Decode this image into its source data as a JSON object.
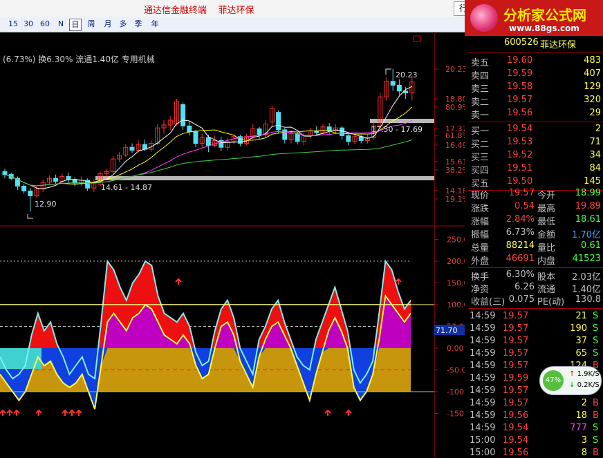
{
  "window": {
    "title": "通达信金融终端    菲达环保",
    "tab_label": "行"
  },
  "toolbar": {
    "periods": [
      "15",
      "30",
      "60",
      "N",
      "日",
      "周",
      "月",
      "多",
      "季",
      "年"
    ],
    "selected": "日"
  },
  "brand": {
    "name": "分析家公式网",
    "url": "www.88gs.com"
  },
  "price_panel": {
    "info_line": "(6.73%) 换6.30% 流通1.40亿 专用机械",
    "y_labels": [
      "20.23",
      "18.80",
      "80.9%",
      "17.37",
      "61.8%",
      "16.49",
      "15.61",
      "38.2%",
      "14.18",
      "19.1%"
    ],
    "annotations": {
      "high": "20.23",
      "low": "12.90",
      "range_upper": "17.50 - 17.69",
      "range_lower": "14.61 - 14.87"
    },
    "candles": [
      {
        "o": 14.95,
        "c": 14.8,
        "h": 15.1,
        "l": 14.6
      },
      {
        "o": 14.8,
        "c": 14.6,
        "h": 14.9,
        "l": 14.5
      },
      {
        "o": 14.6,
        "c": 14.2,
        "h": 14.7,
        "l": 14.0
      },
      {
        "o": 14.2,
        "c": 13.95,
        "h": 14.3,
        "l": 13.8
      },
      {
        "o": 13.95,
        "c": 13.7,
        "h": 14.1,
        "l": 12.9
      },
      {
        "o": 13.7,
        "c": 14.05,
        "h": 14.2,
        "l": 13.6
      },
      {
        "o": 14.05,
        "c": 14.4,
        "h": 14.55,
        "l": 13.9
      },
      {
        "o": 14.4,
        "c": 14.6,
        "h": 14.75,
        "l": 14.3
      },
      {
        "o": 14.6,
        "c": 14.45,
        "h": 14.8,
        "l": 14.3
      },
      {
        "o": 14.45,
        "c": 14.7,
        "h": 14.85,
        "l": 14.35
      },
      {
        "o": 14.7,
        "c": 14.55,
        "h": 14.9,
        "l": 14.4
      },
      {
        "o": 14.55,
        "c": 14.35,
        "h": 14.65,
        "l": 14.2
      },
      {
        "o": 14.35,
        "c": 14.5,
        "h": 14.7,
        "l": 14.2
      },
      {
        "o": 14.5,
        "c": 14.1,
        "h": 14.6,
        "l": 13.95
      },
      {
        "o": 14.1,
        "c": 14.4,
        "h": 14.55,
        "l": 13.9
      },
      {
        "o": 14.3,
        "c": 14.85,
        "h": 14.95,
        "l": 14.2
      },
      {
        "o": 14.85,
        "c": 14.95,
        "h": 15.1,
        "l": 14.7
      },
      {
        "o": 14.95,
        "c": 15.6,
        "h": 15.75,
        "l": 14.85
      },
      {
        "o": 15.6,
        "c": 15.8,
        "h": 15.95,
        "l": 15.45
      },
      {
        "o": 15.8,
        "c": 16.2,
        "h": 16.35,
        "l": 15.7
      },
      {
        "o": 16.2,
        "c": 16.05,
        "h": 16.4,
        "l": 15.9
      },
      {
        "o": 16.05,
        "c": 16.35,
        "h": 16.55,
        "l": 15.95
      },
      {
        "o": 16.35,
        "c": 16.1,
        "h": 16.6,
        "l": 16.0
      },
      {
        "o": 16.1,
        "c": 16.4,
        "h": 16.55,
        "l": 15.95
      },
      {
        "o": 16.4,
        "c": 17.2,
        "h": 17.4,
        "l": 16.3
      },
      {
        "o": 17.2,
        "c": 17.35,
        "h": 17.6,
        "l": 16.9
      },
      {
        "o": 17.35,
        "c": 17.6,
        "h": 17.8,
        "l": 17.1
      },
      {
        "o": 17.4,
        "c": 18.55,
        "h": 18.7,
        "l": 17.3
      },
      {
        "o": 18.4,
        "c": 17.3,
        "h": 18.5,
        "l": 17.1
      },
      {
        "o": 17.3,
        "c": 17.0,
        "h": 17.55,
        "l": 16.8
      },
      {
        "o": 17.0,
        "c": 16.4,
        "h": 17.1,
        "l": 16.2
      },
      {
        "o": 16.4,
        "c": 16.7,
        "h": 16.9,
        "l": 16.2
      },
      {
        "o": 16.7,
        "c": 16.3,
        "h": 16.85,
        "l": 15.95
      },
      {
        "o": 16.3,
        "c": 16.55,
        "h": 16.8,
        "l": 16.2
      },
      {
        "o": 16.55,
        "c": 16.2,
        "h": 16.75,
        "l": 16.0
      },
      {
        "o": 16.2,
        "c": 16.5,
        "h": 16.7,
        "l": 16.05
      },
      {
        "o": 16.5,
        "c": 16.75,
        "h": 16.9,
        "l": 16.35
      },
      {
        "o": 16.75,
        "c": 16.4,
        "h": 16.85,
        "l": 16.25
      },
      {
        "o": 16.4,
        "c": 16.75,
        "h": 16.9,
        "l": 16.3
      },
      {
        "o": 16.75,
        "c": 17.15,
        "h": 17.4,
        "l": 16.6
      },
      {
        "o": 17.15,
        "c": 16.85,
        "h": 17.25,
        "l": 16.6
      },
      {
        "o": 16.85,
        "c": 17.4,
        "h": 17.6,
        "l": 16.75
      },
      {
        "o": 17.5,
        "c": 18.2,
        "h": 18.35,
        "l": 17.3
      },
      {
        "o": 18.0,
        "c": 17.1,
        "h": 18.1,
        "l": 16.9
      },
      {
        "o": 17.1,
        "c": 16.6,
        "h": 17.2,
        "l": 16.4
      },
      {
        "o": 16.6,
        "c": 16.9,
        "h": 17.1,
        "l": 16.4
      },
      {
        "o": 16.9,
        "c": 16.5,
        "h": 17.0,
        "l": 16.35
      },
      {
        "o": 16.5,
        "c": 16.8,
        "h": 16.95,
        "l": 16.3
      },
      {
        "o": 16.8,
        "c": 17.05,
        "h": 17.2,
        "l": 16.65
      },
      {
        "o": 17.05,
        "c": 16.95,
        "h": 17.3,
        "l": 16.8
      },
      {
        "o": 16.95,
        "c": 17.25,
        "h": 17.4,
        "l": 16.85
      },
      {
        "o": 17.25,
        "c": 17.05,
        "h": 17.45,
        "l": 16.9
      },
      {
        "o": 17.05,
        "c": 17.2,
        "h": 17.4,
        "l": 16.9
      },
      {
        "o": 17.2,
        "c": 16.8,
        "h": 17.3,
        "l": 16.6
      },
      {
        "o": 16.8,
        "c": 16.5,
        "h": 16.95,
        "l": 16.3
      },
      {
        "o": 16.5,
        "c": 16.75,
        "h": 16.9,
        "l": 16.35
      },
      {
        "o": 16.75,
        "c": 16.55,
        "h": 16.85,
        "l": 16.4
      },
      {
        "o": 16.55,
        "c": 16.7,
        "h": 16.85,
        "l": 16.4
      },
      {
        "o": 16.7,
        "c": 17.3,
        "h": 17.5,
        "l": 16.6
      },
      {
        "o": 17.3,
        "c": 18.8,
        "h": 19.0,
        "l": 17.2
      },
      {
        "o": 18.8,
        "c": 19.6,
        "h": 19.8,
        "l": 18.6
      },
      {
        "o": 19.6,
        "c": 19.4,
        "h": 20.23,
        "l": 19.1
      },
      {
        "o": 19.4,
        "c": 19.1,
        "h": 19.7,
        "l": 18.9
      },
      {
        "o": 19.1,
        "c": 19.0,
        "h": 19.3,
        "l": 18.7
      },
      {
        "o": 19.0,
        "c": 19.57,
        "h": 19.89,
        "l": 18.61
      }
    ]
  },
  "indicator_panel": {
    "y_labels": [
      "250.00",
      "200.00",
      "150.00",
      "100.00",
      "50.00",
      "0.00",
      "-50.00",
      "-100.00",
      "-150.00"
    ],
    "current_value": "71.70",
    "upper": [
      -20,
      -50,
      -70,
      -60,
      -40,
      30,
      80,
      40,
      60,
      10,
      -20,
      -60,
      -40,
      -20,
      -60,
      -70,
      60,
      200,
      180,
      140,
      110,
      150,
      170,
      200,
      190,
      120,
      80,
      70,
      60,
      80,
      50,
      -10,
      -40,
      -30,
      40,
      90,
      110,
      70,
      0,
      -30,
      -60,
      20,
      50,
      90,
      110,
      60,
      20,
      -20,
      -40,
      -50,
      20,
      60,
      100,
      140,
      90,
      40,
      -50,
      -80,
      -60,
      -30,
      80,
      200,
      180,
      130,
      90,
      110
    ],
    "lower": [
      -60,
      -80,
      -100,
      -120,
      -100,
      -60,
      -20,
      -40,
      -30,
      -60,
      -80,
      -90,
      -80,
      -60,
      -100,
      -140,
      -40,
      60,
      80,
      60,
      40,
      70,
      80,
      100,
      90,
      60,
      30,
      20,
      10,
      30,
      10,
      -40,
      -70,
      -60,
      0,
      50,
      60,
      30,
      -30,
      -60,
      -90,
      -20,
      20,
      50,
      60,
      30,
      0,
      -40,
      -80,
      -120,
      -60,
      -10,
      40,
      70,
      40,
      0,
      -90,
      -120,
      -100,
      -60,
      20,
      120,
      100,
      80,
      60,
      80
    ]
  },
  "quote": {
    "code": "600526",
    "name": "菲达环保",
    "asks": [
      {
        "label": "卖五",
        "price": "19.60",
        "vol": "483"
      },
      {
        "label": "卖四",
        "price": "19.59",
        "vol": "407"
      },
      {
        "label": "卖三",
        "price": "19.58",
        "vol": "129"
      },
      {
        "label": "卖二",
        "price": "19.57",
        "vol": "320"
      },
      {
        "label": "卖一",
        "price": "19.56",
        "vol": "29"
      }
    ],
    "bids": [
      {
        "label": "买一",
        "price": "19.54",
        "vol": "2"
      },
      {
        "label": "买二",
        "price": "19.53",
        "vol": "71"
      },
      {
        "label": "买三",
        "price": "19.52",
        "vol": "34"
      },
      {
        "label": "买四",
        "price": "19.51",
        "vol": "84"
      },
      {
        "label": "买五",
        "price": "19.50",
        "vol": "145"
      }
    ],
    "stats": [
      {
        "l1": "现价",
        "v1": "19.57",
        "l2": "今开",
        "v2": "18.99"
      },
      {
        "l1": "涨跌",
        "v1": "0.54",
        "l2": "最高",
        "v2": "19.89"
      },
      {
        "l1": "涨幅",
        "v1": "2.84%",
        "l2": "最低",
        "v2": "18.61"
      },
      {
        "l1": "振幅",
        "v1": "6.73%",
        "l2": "金额",
        "v2": "1.70亿"
      },
      {
        "l1": "总量",
        "v1": "88214",
        "l2": "量比",
        "v2": "0.61"
      },
      {
        "l1": "外盘",
        "v1": "46691",
        "l2": "内盘",
        "v2": "41523"
      }
    ],
    "stats2": [
      {
        "l1": "换手",
        "v1": "6.30%",
        "l2": "股本",
        "v2": "2.03亿"
      },
      {
        "l1": "净资",
        "v1": "6.26",
        "l2": "流通",
        "v2": "1.40亿"
      },
      {
        "l1": "收益(三)",
        "v1": "0.075",
        "l2": "PE(动)",
        "v2": "130.8"
      }
    ],
    "ticks": [
      {
        "t": "14:59",
        "p": "19.57",
        "v": "21",
        "s": "S"
      },
      {
        "t": "14:59",
        "p": "19.57",
        "v": "190",
        "s": "S"
      },
      {
        "t": "14:59",
        "p": "19.57",
        "v": "37",
        "s": "S"
      },
      {
        "t": "14:59",
        "p": "19.57",
        "v": "65",
        "s": "S"
      },
      {
        "t": "14:59",
        "p": "19.57",
        "v": "124",
        "s": "B"
      },
      {
        "t": "14:59",
        "p": "19.59",
        "v": "",
        "s": ""
      },
      {
        "t": "14:59",
        "p": "19.57",
        "v": "",
        "s": ""
      },
      {
        "t": "14:59",
        "p": "19.57",
        "v": "2",
        "s": "B"
      },
      {
        "t": "14:59",
        "p": "19.56",
        "v": "18",
        "s": "B"
      },
      {
        "t": "14:59",
        "p": "19.54",
        "v": "777",
        "s": "S"
      },
      {
        "t": "15:00",
        "p": "19.54",
        "v": "3",
        "s": "S"
      },
      {
        "t": "15:00",
        "p": "19.56",
        "v": "8",
        "s": "B"
      }
    ]
  },
  "speed_meter": {
    "percent": "47%",
    "up": "1.9K/S",
    "down": "0.2K/S"
  }
}
